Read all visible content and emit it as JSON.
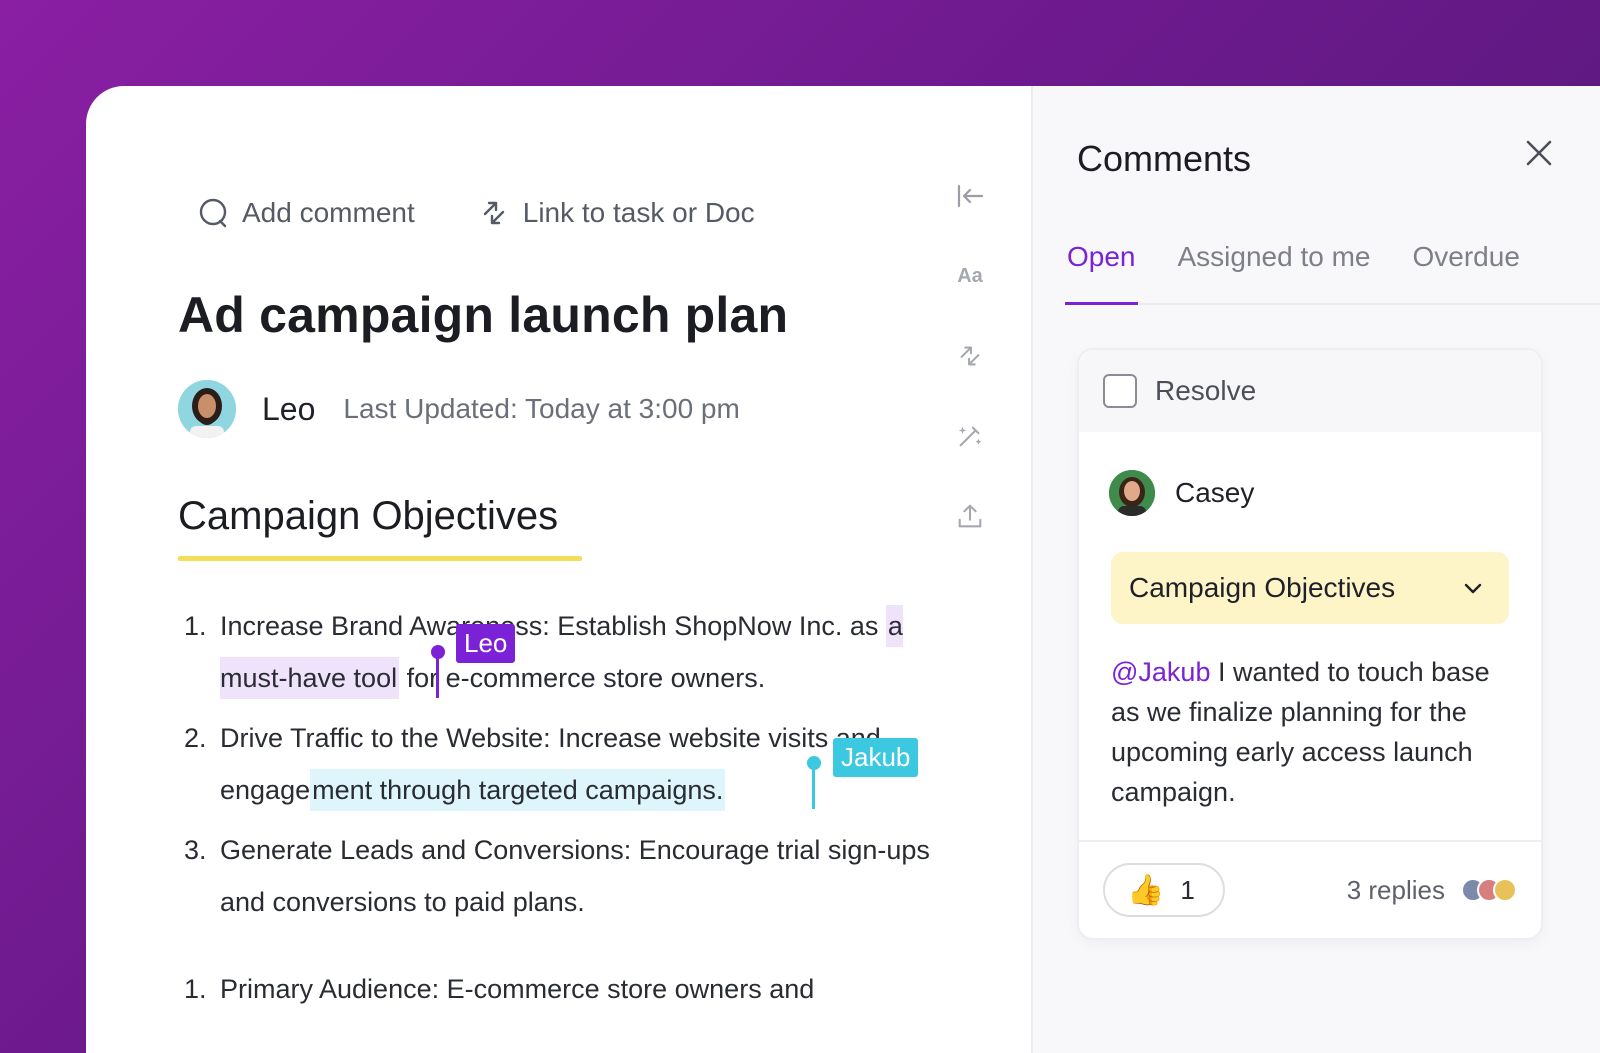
{
  "toolbar": {
    "add_comment": "Add comment",
    "link_task": "Link to task or Doc"
  },
  "doc": {
    "title": "Ad campaign launch plan",
    "author": "Leo",
    "last_updated_label": "Last Updated:",
    "last_updated_value": "Today at 3:00 pm",
    "section_heading": "Campaign Objectives",
    "objectives": [
      {
        "num": "1.",
        "pre": "Increase Brand Awareness: Establish ShopNow Inc. as ",
        "highlight": "a must-have tool",
        "post": " for e-commerce store owners."
      },
      {
        "num": "2.",
        "pre": "Drive Traffic to the Website: Increase website visits and engage",
        "highlight": "ment through targeted campaigns.",
        "post": ""
      },
      {
        "num": "3.",
        "pre": "Generate Leads and Conversions: Encourage trial sign-ups and conversions to paid plans.",
        "highlight": "",
        "post": ""
      }
    ],
    "audience_num": "1.",
    "audience_text": "Primary Audience: E-commerce store owners and"
  },
  "cursors": {
    "leo": "Leo",
    "jakub": "Jakub"
  },
  "rail": {
    "text_format": "Aa"
  },
  "comments": {
    "title": "Comments",
    "tabs": [
      "Open",
      "Assigned to me",
      "Overdue"
    ],
    "active_tab": "Open",
    "card": {
      "resolve": "Resolve",
      "commenter": "Casey",
      "reference": "Campaign Objectives",
      "mention": "@Jakub",
      "body": " I wanted to touch base as we finalize planning for the upcoming early access launch campaign.",
      "reaction_emoji": "👍",
      "reaction_count": "1",
      "replies": "3 replies"
    }
  },
  "colors": {
    "accent": "#7b22d6",
    "highlight_yellow": "#f4dd58",
    "cursor_leo": "#7b22d6",
    "cursor_jakub": "#3cc8e0"
  }
}
